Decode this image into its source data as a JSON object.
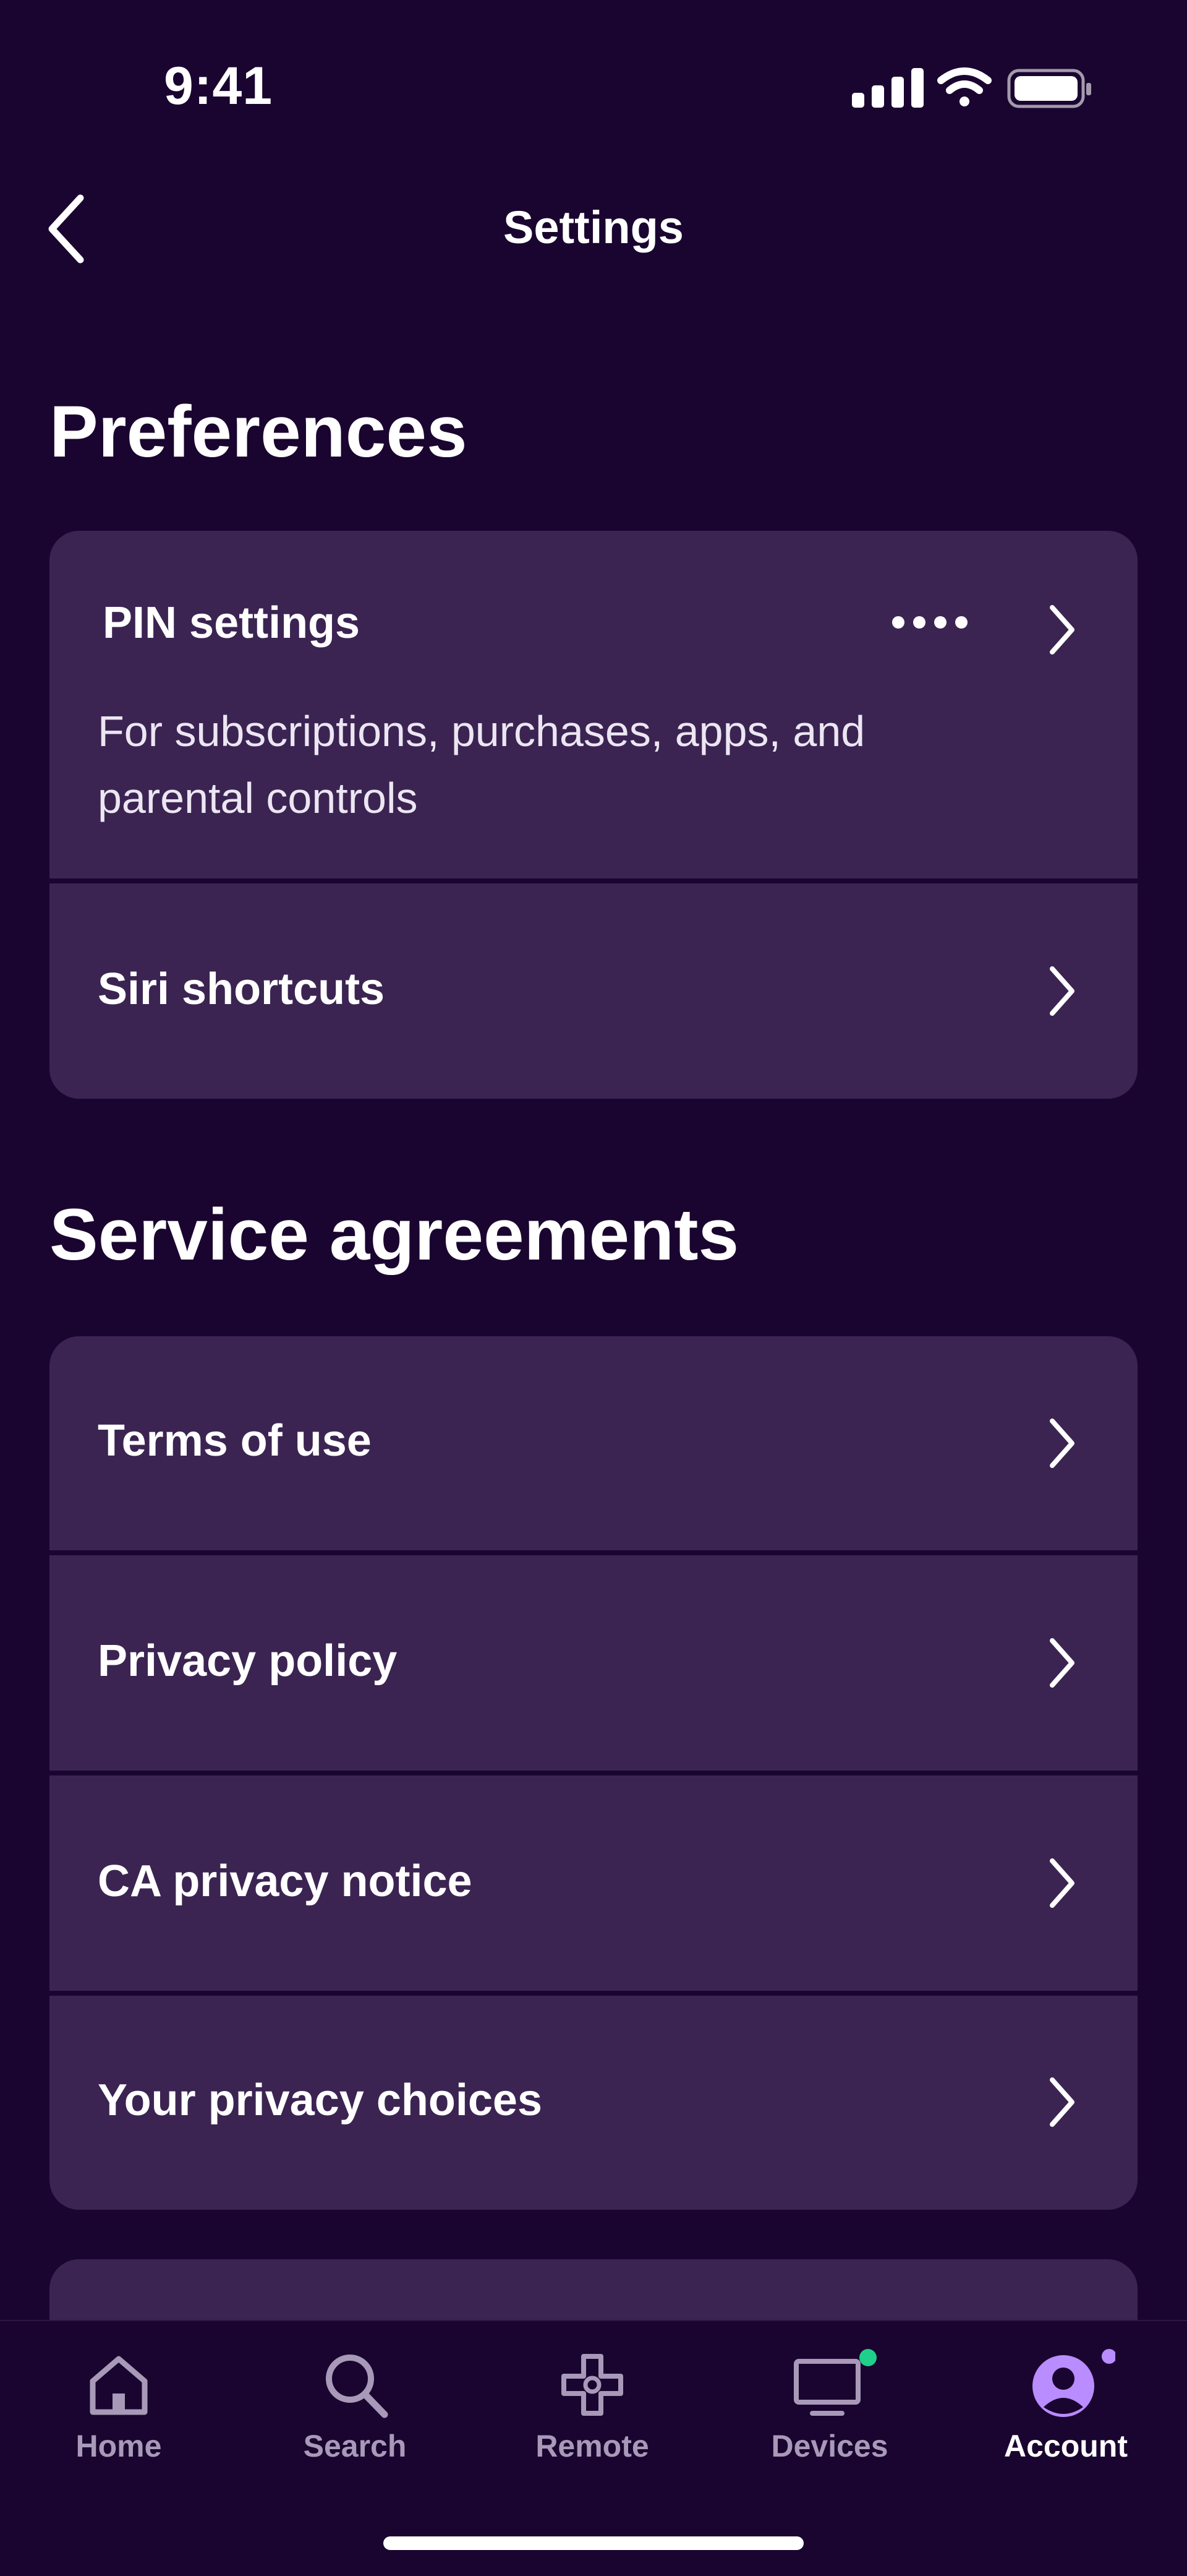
{
  "status_bar": {
    "time": "9:41"
  },
  "header": {
    "title": "Settings"
  },
  "preferences": {
    "title": "Preferences",
    "pin_settings": {
      "label": "PIN settings",
      "description": "For subscriptions, purchases, apps, and parental controls"
    },
    "siri_shortcuts": {
      "label": "Siri shortcuts"
    }
  },
  "service_agreements": {
    "title": "Service agreements",
    "items": [
      {
        "label": "Terms of use"
      },
      {
        "label": "Privacy policy"
      },
      {
        "label": "CA privacy notice"
      },
      {
        "label": "Your privacy choices"
      }
    ]
  },
  "tab_bar": {
    "tabs": [
      {
        "label": "Home",
        "icon": "home-icon"
      },
      {
        "label": "Search",
        "icon": "search-icon"
      },
      {
        "label": "Remote",
        "icon": "remote-icon"
      },
      {
        "label": "Devices",
        "icon": "tv-icon",
        "badge_color": "#1fd08a"
      },
      {
        "label": "Account",
        "icon": "account-icon",
        "badge_color": "#b98cff",
        "active": true
      }
    ]
  },
  "colors": {
    "background": "#1a0530",
    "card": "#3b2452",
    "inactive_tab": "#a899b8",
    "account_accent": "#b98cff",
    "devices_badge": "#1fd08a"
  }
}
